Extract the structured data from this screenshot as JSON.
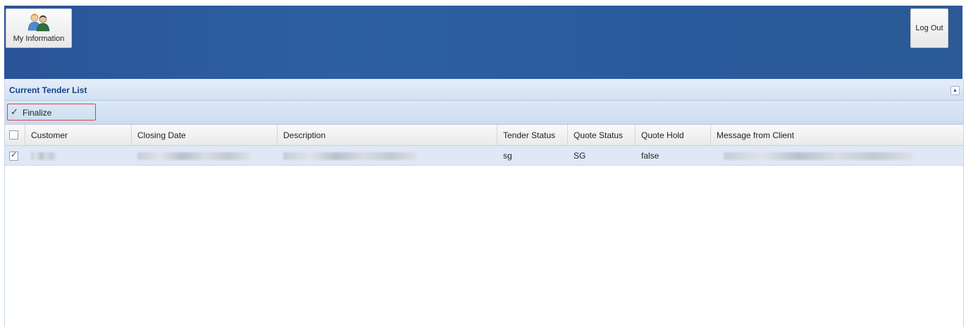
{
  "header": {
    "my_information_label": "My Information",
    "my_information_icon": "users-icon",
    "logout_label": "Log Out",
    "background_color": "#2b5a9e"
  },
  "panel": {
    "title": "Current Tender List",
    "collapse_icon": "collapse-up-icon",
    "toolbar": {
      "finalize_label": "Finalize",
      "finalize_icon": "checkmark-icon"
    }
  },
  "grid": {
    "columns": [
      "",
      "Customer",
      "Closing Date",
      "Description",
      "Tender Status",
      "Quote Status",
      "Quote Hold",
      "Message from Client"
    ],
    "rows": [
      {
        "selected": true,
        "customer": "",
        "closing_date": "",
        "description": "",
        "tender_status": "sg",
        "quote_status": "SG",
        "quote_hold": "false",
        "message_from_client": ""
      }
    ]
  }
}
